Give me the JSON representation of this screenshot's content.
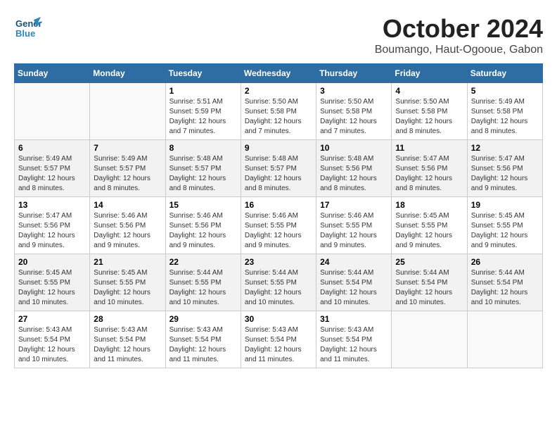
{
  "header": {
    "logo_line1": "General",
    "logo_line2": "Blue",
    "month": "October 2024",
    "location": "Boumango, Haut-Ogooue, Gabon"
  },
  "weekdays": [
    "Sunday",
    "Monday",
    "Tuesday",
    "Wednesday",
    "Thursday",
    "Friday",
    "Saturday"
  ],
  "weeks": [
    [
      {
        "day": "",
        "info": ""
      },
      {
        "day": "",
        "info": ""
      },
      {
        "day": "1",
        "info": "Sunrise: 5:51 AM\nSunset: 5:59 PM\nDaylight: 12 hours\nand 7 minutes."
      },
      {
        "day": "2",
        "info": "Sunrise: 5:50 AM\nSunset: 5:58 PM\nDaylight: 12 hours\nand 7 minutes."
      },
      {
        "day": "3",
        "info": "Sunrise: 5:50 AM\nSunset: 5:58 PM\nDaylight: 12 hours\nand 7 minutes."
      },
      {
        "day": "4",
        "info": "Sunrise: 5:50 AM\nSunset: 5:58 PM\nDaylight: 12 hours\nand 8 minutes."
      },
      {
        "day": "5",
        "info": "Sunrise: 5:49 AM\nSunset: 5:58 PM\nDaylight: 12 hours\nand 8 minutes."
      }
    ],
    [
      {
        "day": "6",
        "info": "Sunrise: 5:49 AM\nSunset: 5:57 PM\nDaylight: 12 hours\nand 8 minutes."
      },
      {
        "day": "7",
        "info": "Sunrise: 5:49 AM\nSunset: 5:57 PM\nDaylight: 12 hours\nand 8 minutes."
      },
      {
        "day": "8",
        "info": "Sunrise: 5:48 AM\nSunset: 5:57 PM\nDaylight: 12 hours\nand 8 minutes."
      },
      {
        "day": "9",
        "info": "Sunrise: 5:48 AM\nSunset: 5:57 PM\nDaylight: 12 hours\nand 8 minutes."
      },
      {
        "day": "10",
        "info": "Sunrise: 5:48 AM\nSunset: 5:56 PM\nDaylight: 12 hours\nand 8 minutes."
      },
      {
        "day": "11",
        "info": "Sunrise: 5:47 AM\nSunset: 5:56 PM\nDaylight: 12 hours\nand 8 minutes."
      },
      {
        "day": "12",
        "info": "Sunrise: 5:47 AM\nSunset: 5:56 PM\nDaylight: 12 hours\nand 9 minutes."
      }
    ],
    [
      {
        "day": "13",
        "info": "Sunrise: 5:47 AM\nSunset: 5:56 PM\nDaylight: 12 hours\nand 9 minutes."
      },
      {
        "day": "14",
        "info": "Sunrise: 5:46 AM\nSunset: 5:56 PM\nDaylight: 12 hours\nand 9 minutes."
      },
      {
        "day": "15",
        "info": "Sunrise: 5:46 AM\nSunset: 5:56 PM\nDaylight: 12 hours\nand 9 minutes."
      },
      {
        "day": "16",
        "info": "Sunrise: 5:46 AM\nSunset: 5:55 PM\nDaylight: 12 hours\nand 9 minutes."
      },
      {
        "day": "17",
        "info": "Sunrise: 5:46 AM\nSunset: 5:55 PM\nDaylight: 12 hours\nand 9 minutes."
      },
      {
        "day": "18",
        "info": "Sunrise: 5:45 AM\nSunset: 5:55 PM\nDaylight: 12 hours\nand 9 minutes."
      },
      {
        "day": "19",
        "info": "Sunrise: 5:45 AM\nSunset: 5:55 PM\nDaylight: 12 hours\nand 9 minutes."
      }
    ],
    [
      {
        "day": "20",
        "info": "Sunrise: 5:45 AM\nSunset: 5:55 PM\nDaylight: 12 hours\nand 10 minutes."
      },
      {
        "day": "21",
        "info": "Sunrise: 5:45 AM\nSunset: 5:55 PM\nDaylight: 12 hours\nand 10 minutes."
      },
      {
        "day": "22",
        "info": "Sunrise: 5:44 AM\nSunset: 5:55 PM\nDaylight: 12 hours\nand 10 minutes."
      },
      {
        "day": "23",
        "info": "Sunrise: 5:44 AM\nSunset: 5:55 PM\nDaylight: 12 hours\nand 10 minutes."
      },
      {
        "day": "24",
        "info": "Sunrise: 5:44 AM\nSunset: 5:54 PM\nDaylight: 12 hours\nand 10 minutes."
      },
      {
        "day": "25",
        "info": "Sunrise: 5:44 AM\nSunset: 5:54 PM\nDaylight: 12 hours\nand 10 minutes."
      },
      {
        "day": "26",
        "info": "Sunrise: 5:44 AM\nSunset: 5:54 PM\nDaylight: 12 hours\nand 10 minutes."
      }
    ],
    [
      {
        "day": "27",
        "info": "Sunrise: 5:43 AM\nSunset: 5:54 PM\nDaylight: 12 hours\nand 10 minutes."
      },
      {
        "day": "28",
        "info": "Sunrise: 5:43 AM\nSunset: 5:54 PM\nDaylight: 12 hours\nand 11 minutes."
      },
      {
        "day": "29",
        "info": "Sunrise: 5:43 AM\nSunset: 5:54 PM\nDaylight: 12 hours\nand 11 minutes."
      },
      {
        "day": "30",
        "info": "Sunrise: 5:43 AM\nSunset: 5:54 PM\nDaylight: 12 hours\nand 11 minutes."
      },
      {
        "day": "31",
        "info": "Sunrise: 5:43 AM\nSunset: 5:54 PM\nDaylight: 12 hours\nand 11 minutes."
      },
      {
        "day": "",
        "info": ""
      },
      {
        "day": "",
        "info": ""
      }
    ]
  ]
}
